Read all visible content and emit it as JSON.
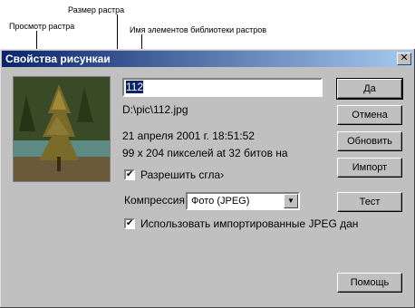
{
  "callouts": {
    "preview": "Просмотр растра",
    "size": "Размер растра",
    "names": "Имя элементов библиотеки растров"
  },
  "dialog": {
    "title": "Свойства рисункаи",
    "close": "✕",
    "name_value": "112",
    "path": "D:\\pic\\112.jpg",
    "datetime": "21 апреля 2001 г.  18:51:52",
    "dimensions": "99 x 204 пикселей at 32 битов на",
    "smooth_label": "Разрешить сгла›",
    "smooth_checked": "✔",
    "compression_label": "Компрессия",
    "compression_value": "Фото (JPEG)",
    "compression_arrow": "▼",
    "use_jpeg_label": "Использовать импортированные JPEG дан",
    "use_jpeg_checked": "✔"
  },
  "buttons": {
    "ok": "Да",
    "cancel": "Отмена",
    "refresh": "Обновить",
    "import": "Импорт",
    "test": "Тест",
    "help": "Помощь"
  },
  "colors": {
    "titlebar_start": "#0a246a",
    "titlebar_end": "#a6caf0",
    "dialog_face": "#c0c0c0"
  }
}
